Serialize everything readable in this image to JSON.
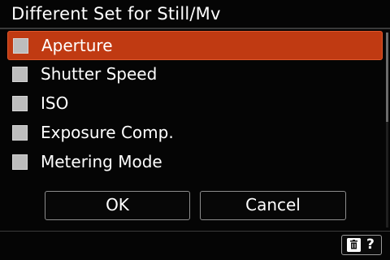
{
  "header": {
    "title": "Different Set for Still/Mv"
  },
  "list": {
    "items": [
      {
        "label": "Aperture",
        "selected": true,
        "checked": false
      },
      {
        "label": "Shutter Speed",
        "selected": false,
        "checked": false
      },
      {
        "label": "ISO",
        "selected": false,
        "checked": false
      },
      {
        "label": "Exposure Comp.",
        "selected": false,
        "checked": false
      },
      {
        "label": "Metering Mode",
        "selected": false,
        "checked": false
      }
    ]
  },
  "buttons": {
    "ok_label": "OK",
    "cancel_label": "Cancel"
  },
  "footer": {
    "help_text": "?",
    "trash_icon": "trash-icon"
  },
  "colors": {
    "highlight": "#c03a12",
    "checkbox": "#bdbdbd",
    "background": "#050505"
  }
}
